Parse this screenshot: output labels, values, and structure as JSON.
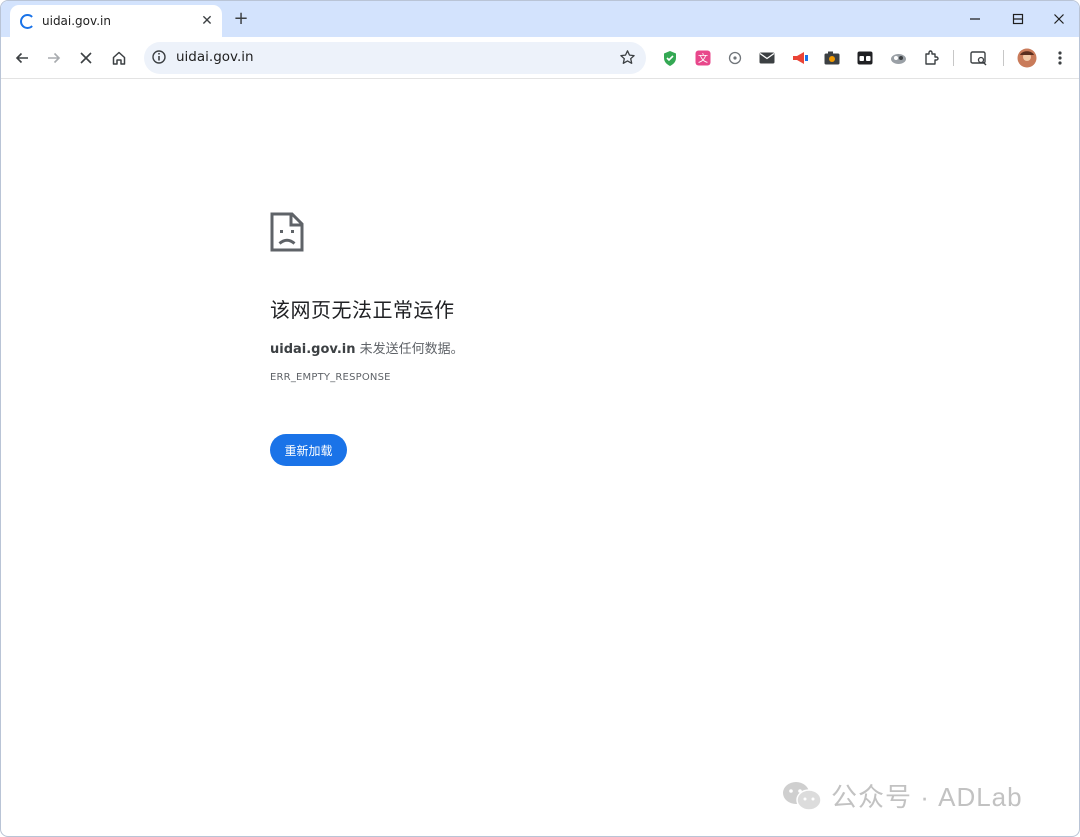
{
  "tab": {
    "title": "uidai.gov.in",
    "close_glyph": "✕"
  },
  "newtab_glyph": "+",
  "address_bar": {
    "url": "uidai.gov.in"
  },
  "error": {
    "title": "该网页无法正常运作",
    "host": "uidai.gov.in",
    "message": " 未发送任何数据。",
    "code": "ERR_EMPTY_RESPONSE",
    "reload_label": "重新加载"
  },
  "watermark": {
    "text": "公众号 · ADLab"
  },
  "colors": {
    "accent": "#1a73e8",
    "tabstrip": "#d3e3fd",
    "omnibox": "#edf2fa"
  },
  "icons": [
    "back-icon",
    "forward-icon",
    "stop-icon",
    "home-icon",
    "site-info-icon",
    "bookmark-star-icon",
    "extensions-icon",
    "menu-icon"
  ]
}
